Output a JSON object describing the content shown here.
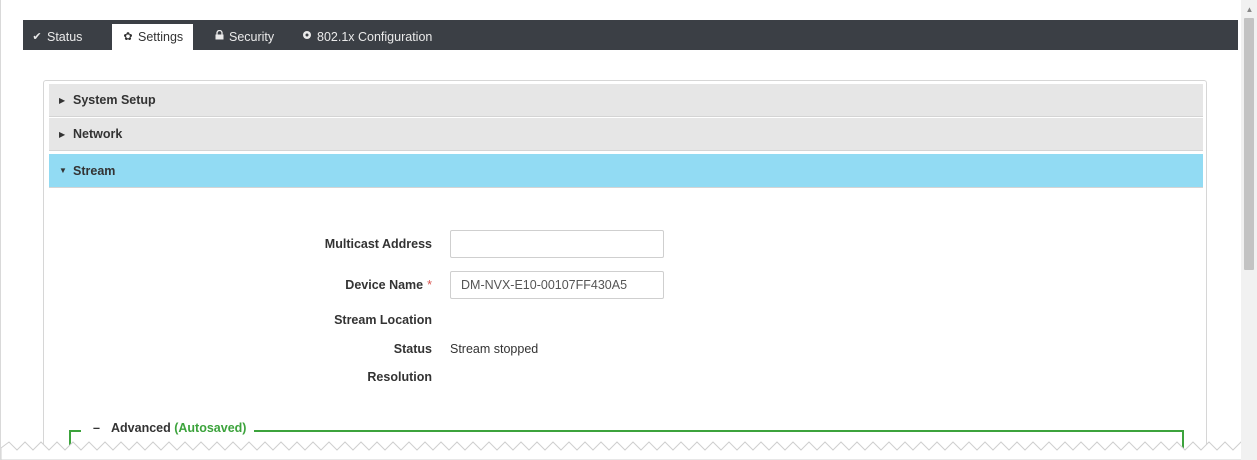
{
  "tabs": [
    {
      "label": "Status",
      "icon": "check-icon",
      "glyph": "✔"
    },
    {
      "label": "Settings",
      "icon": "gear-icon",
      "glyph": "✿"
    },
    {
      "label": "Security",
      "icon": "lock-icon",
      "glyph": "🔒"
    },
    {
      "label": "802.1x Configuration",
      "icon": "cog-icon",
      "glyph": "✹"
    }
  ],
  "active_tab": "Settings",
  "accordion": {
    "system_setup": "System Setup",
    "network": "Network",
    "stream": "Stream"
  },
  "form": {
    "multicast_label": "Multicast Address",
    "multicast_value": "",
    "device_name_label": "Device Name",
    "device_name_required": "*",
    "device_name_value": "DM-NVX-E10-00107FF430A5",
    "stream_location_label": "Stream Location",
    "status_label": "Status",
    "status_value": "Stream stopped",
    "resolution_label": "Resolution"
  },
  "advanced": {
    "toggle": "–",
    "label": "Advanced",
    "autosaved": "(Autosaved)"
  },
  "colors": {
    "nav_bg": "#3b3f45",
    "stream_header": "#92dbf3",
    "accordion_bg": "#e6e6e6",
    "advanced_border": "#3ca33c",
    "required": "#d9534f"
  }
}
